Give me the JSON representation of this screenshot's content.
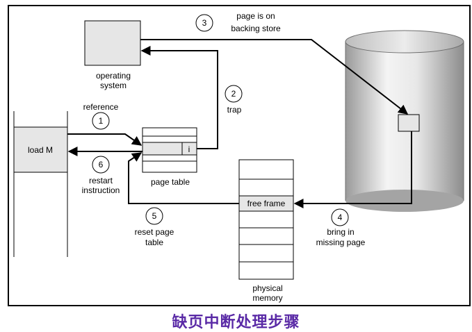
{
  "diagram": {
    "os_label_1": "operating",
    "os_label_2": "system",
    "load_label": "load M",
    "reference_label": "reference",
    "trap_label": "trap",
    "backing_label_1": "page is on",
    "backing_label_2": "backing store",
    "page_table_label": "page table",
    "invalid_bit": "i",
    "restart_label_1": "restart",
    "restart_label_2": "instruction",
    "reset_label_1": "reset page",
    "reset_label_2": "table",
    "bring_label_1": "bring in",
    "bring_label_2": "missing page",
    "free_frame_label": "free frame",
    "memory_label_1": "physical",
    "memory_label_2": "memory",
    "steps": [
      "1",
      "2",
      "3",
      "4",
      "5",
      "6"
    ]
  },
  "caption": "缺页中断处理步骤",
  "colors": {
    "box_fill": "#e6e6e6",
    "cylinder_mid": "#f2f2f2",
    "cylinder_edge": "#8c8c8c",
    "caption": "#5a2aa6"
  }
}
